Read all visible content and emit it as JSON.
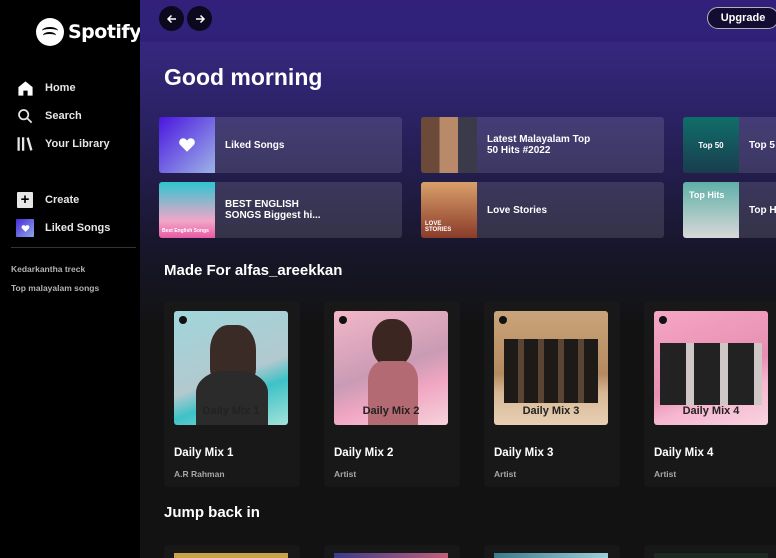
{
  "app": {
    "logo_text": "Spotify",
    "accent": "#1db954"
  },
  "sidebar": {
    "nav": [
      {
        "label": "Home",
        "icon": "home-icon"
      },
      {
        "label": "Search",
        "icon": "search-icon"
      },
      {
        "label": "Your Library",
        "icon": "library-icon"
      }
    ],
    "actions": [
      {
        "label": "Create",
        "icon": "plus-icon"
      },
      {
        "label": "Liked Songs",
        "icon": "heart-icon"
      }
    ],
    "playlists": [
      "Kedarkantha treck",
      "Top malayalam songs"
    ]
  },
  "topbar": {
    "back_icon": "arrow-left-icon",
    "forward_icon": "arrow-right-icon",
    "upgrade_label": "Upgrade"
  },
  "main": {
    "greeting": "Good morning",
    "quick_picks": [
      {
        "title": "Liked Songs"
      },
      {
        "title": "Latest Malayalam Top 50 Hits #2022"
      },
      {
        "title": "Top 5"
      },
      {
        "title": "BEST ENGLISH SONGS Biggest hi..."
      },
      {
        "title": "Love Stories"
      },
      {
        "title": "Top H"
      }
    ],
    "made_for_title": "Made For alfas_areekkan",
    "mixes": [
      {
        "cover_label": "Daily Mix 1",
        "title": "Daily Mix 1",
        "subtitle": "A.R Rahman"
      },
      {
        "cover_label": "Daily Mix 2",
        "title": "Daily Mix 2",
        "subtitle": "Artist"
      },
      {
        "cover_label": "Daily Mix 3",
        "title": "Daily Mix 3",
        "subtitle": "Artist"
      },
      {
        "cover_label": "Daily Mix 4",
        "title": "Daily Mix 4",
        "subtitle": "Artist"
      }
    ],
    "jump_back_title": "Jump back in"
  },
  "thumb_labels": {
    "top50": "Top 50",
    "love_stories": "LOVE STORIES",
    "top_hits": "Top Hits",
    "best_english": "Best English Songs"
  }
}
